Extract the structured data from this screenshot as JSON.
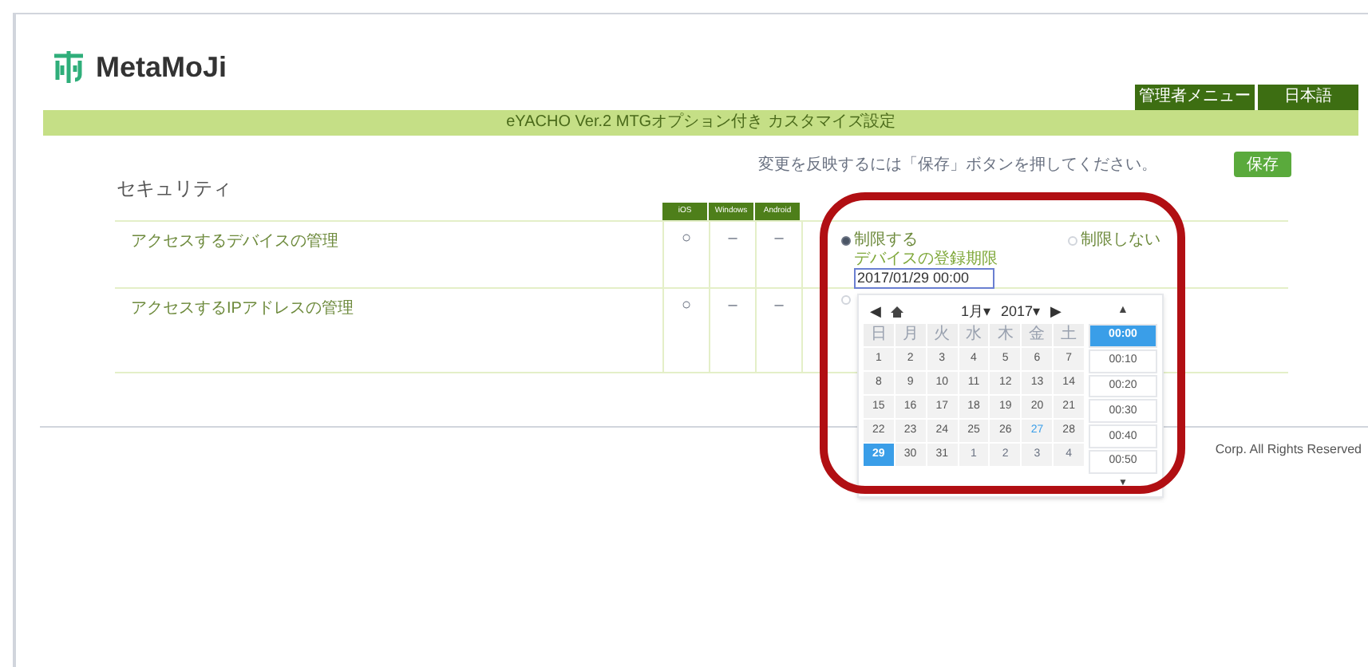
{
  "logo": {
    "text": "MetaMoJi"
  },
  "nav": [
    {
      "label": "管理者メニュー"
    },
    {
      "label": "日本語"
    }
  ],
  "title_bar": "eYACHO Ver.2 MTGオプション付き カスタマイズ設定",
  "save_hint": "変更を反映するには「保存」ボタンを押してください。",
  "save_button": "保存",
  "section_title": "セキュリティ",
  "table": {
    "columns": [
      "iOS",
      "Windows",
      "Android"
    ],
    "rows": [
      {
        "label": "アクセスするデバイスの管理",
        "cells": [
          "○",
          "–",
          "–"
        ],
        "options": [
          {
            "label": "制限する",
            "selected": true
          },
          {
            "label": "制限しない",
            "selected": false
          }
        ],
        "expiry_label": "デバイスの登録期限",
        "expiry_value": "2017/01/29 00:00"
      },
      {
        "label": "アクセスするIPアドレスの管理",
        "cells": [
          "○",
          "–",
          "–"
        ],
        "options": [
          {
            "selected": false
          }
        ]
      }
    ]
  },
  "date_picker": {
    "prev": "◀",
    "next": "▶",
    "month": "1月▾",
    "year": "2017▾",
    "time_up": "▲",
    "time_down": "▼",
    "weekdays": [
      "日",
      "月",
      "火",
      "水",
      "木",
      "金",
      "土"
    ],
    "days": [
      {
        "label": "1",
        "kind": "current",
        "selected": false,
        "today": false
      },
      {
        "label": "2",
        "kind": "current",
        "selected": false,
        "today": false
      },
      {
        "label": "3",
        "kind": "current",
        "selected": false,
        "today": false
      },
      {
        "label": "4",
        "kind": "current",
        "selected": false,
        "today": false
      },
      {
        "label": "5",
        "kind": "current",
        "selected": false,
        "today": false
      },
      {
        "label": "6",
        "kind": "current",
        "selected": false,
        "today": false
      },
      {
        "label": "7",
        "kind": "current",
        "selected": false,
        "today": false
      },
      {
        "label": "8",
        "kind": "current",
        "selected": false,
        "today": false
      },
      {
        "label": "9",
        "kind": "current",
        "selected": false,
        "today": false
      },
      {
        "label": "10",
        "kind": "current",
        "selected": false,
        "today": false
      },
      {
        "label": "11",
        "kind": "current",
        "selected": false,
        "today": false
      },
      {
        "label": "12",
        "kind": "current",
        "selected": false,
        "today": false
      },
      {
        "label": "13",
        "kind": "current",
        "selected": false,
        "today": false
      },
      {
        "label": "14",
        "kind": "current",
        "selected": false,
        "today": false
      },
      {
        "label": "15",
        "kind": "current",
        "selected": false,
        "today": false
      },
      {
        "label": "16",
        "kind": "current",
        "selected": false,
        "today": false
      },
      {
        "label": "17",
        "kind": "current",
        "selected": false,
        "today": false
      },
      {
        "label": "18",
        "kind": "current",
        "selected": false,
        "today": false
      },
      {
        "label": "19",
        "kind": "current",
        "selected": false,
        "today": false
      },
      {
        "label": "20",
        "kind": "current",
        "selected": false,
        "today": false
      },
      {
        "label": "21",
        "kind": "current",
        "selected": false,
        "today": false
      },
      {
        "label": "22",
        "kind": "current",
        "selected": false,
        "today": false
      },
      {
        "label": "23",
        "kind": "current",
        "selected": false,
        "today": false
      },
      {
        "label": "24",
        "kind": "current",
        "selected": false,
        "today": false
      },
      {
        "label": "25",
        "kind": "current",
        "selected": false,
        "today": false
      },
      {
        "label": "26",
        "kind": "current",
        "selected": false,
        "today": false
      },
      {
        "label": "27",
        "kind": "current",
        "selected": false,
        "today": true
      },
      {
        "label": "28",
        "kind": "current",
        "selected": false,
        "today": false
      },
      {
        "label": "29",
        "kind": "current",
        "selected": true,
        "today": false
      },
      {
        "label": "30",
        "kind": "current",
        "selected": false,
        "today": false
      },
      {
        "label": "31",
        "kind": "current",
        "selected": false,
        "today": false
      },
      {
        "label": "1",
        "kind": "other",
        "selected": false,
        "today": false
      },
      {
        "label": "2",
        "kind": "other",
        "selected": false,
        "today": false
      },
      {
        "label": "3",
        "kind": "other",
        "selected": false,
        "today": false
      },
      {
        "label": "4",
        "kind": "other",
        "selected": false,
        "today": false
      }
    ],
    "times": [
      {
        "label": "00:00",
        "selected": true
      },
      {
        "label": "00:10",
        "selected": false
      },
      {
        "label": "00:20",
        "selected": false
      },
      {
        "label": "00:30",
        "selected": false
      },
      {
        "label": "00:40",
        "selected": false
      },
      {
        "label": "00:50",
        "selected": false
      }
    ]
  },
  "footer": "Corp. All Rights Reserved"
}
